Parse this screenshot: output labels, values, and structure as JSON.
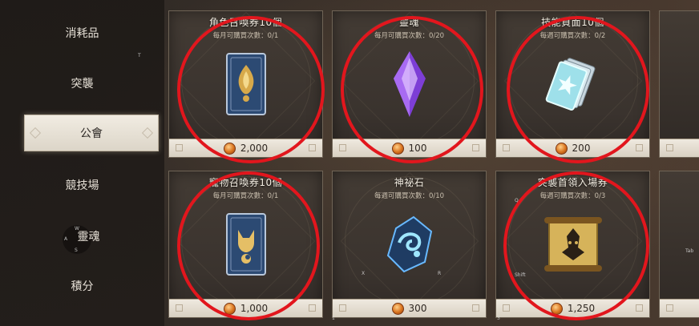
{
  "sidebar": {
    "items": [
      {
        "label": "消耗品"
      },
      {
        "label": "突襲"
      },
      {
        "label": "公會",
        "active": true
      },
      {
        "label": "競技場"
      },
      {
        "label": "靈魂"
      },
      {
        "label": "積分"
      }
    ],
    "key_hints": [
      "T",
      "W",
      "A",
      "S"
    ]
  },
  "cards": [
    {
      "title": "角色召喚券10個",
      "limit": "每月可購買次數：0/1",
      "price": "2,000",
      "icon": "character-summon-ticket-icon"
    },
    {
      "title": "靈魂",
      "limit": "每月可購買次數：0/20",
      "price": "100",
      "icon": "soul-crystal-icon"
    },
    {
      "title": "技能頁面10個",
      "limit": "每週可購買次數：0/2",
      "price": "200",
      "icon": "skill-page-cards-icon"
    },
    {
      "title": "寵物召喚券10個",
      "limit": "每月可購買次數：0/1",
      "price": "1,000",
      "icon": "pet-summon-ticket-icon"
    },
    {
      "title": "神祕石",
      "limit": "每週可購買次數：0/10",
      "price": "300",
      "icon": "mystic-stone-icon"
    },
    {
      "title": "突襲首領入場券",
      "limit": "每週可購買次數：0/3",
      "price": "1,250",
      "icon": "raid-boss-scroll-icon"
    }
  ],
  "overlay_key_hints": [
    "Q",
    "X",
    "R",
    "Shift",
    "1",
    "3",
    "Tab"
  ],
  "colors": {
    "highlight": "#e2161d",
    "coin": "#d9731e",
    "active_tab": "#f1ece2"
  }
}
